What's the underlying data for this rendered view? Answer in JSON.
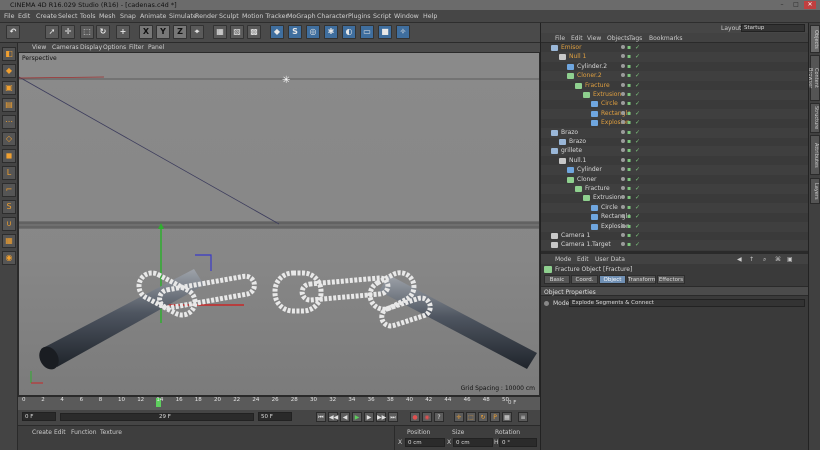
{
  "window": {
    "title": "CINEMA 4D R16.029 Studio (R16) - [cadenas.c4d *]",
    "buttons": [
      "–",
      "□",
      "✕"
    ]
  },
  "menubar": [
    "File",
    "Edit",
    "Create",
    "Select",
    "Tools",
    "Mesh",
    "Snap",
    "Animate",
    "Simulate",
    "Render",
    "Sculpt",
    "Motion Tracker",
    "MoGraph",
    "Character",
    "Plugins",
    "Script",
    "Window",
    "Help"
  ],
  "toolbar": {
    "buttons": [
      {
        "name": "undo-icon",
        "glyph": "↶"
      },
      {
        "name": "select-arrow-icon",
        "glyph": "➚"
      },
      {
        "name": "move-icon",
        "glyph": "✛"
      },
      {
        "name": "scale-icon",
        "glyph": "⬚"
      },
      {
        "name": "rotate-icon",
        "glyph": "↻"
      },
      {
        "name": "add-icon",
        "glyph": "+"
      },
      {
        "name": "x-axis-icon",
        "glyph": "X"
      },
      {
        "name": "y-axis-icon",
        "glyph": "Y"
      },
      {
        "name": "z-axis-icon",
        "glyph": "Z"
      },
      {
        "name": "coord-system-icon",
        "glyph": "⌖"
      },
      {
        "name": "render-view-icon",
        "glyph": "▦"
      },
      {
        "name": "render-picture-viewer-icon",
        "glyph": "▧"
      },
      {
        "name": "render-settings-icon",
        "glyph": "▩"
      },
      {
        "name": "cube-icon",
        "glyph": "◆"
      },
      {
        "name": "spline-icon",
        "glyph": "S"
      },
      {
        "name": "nurbs-icon",
        "glyph": "◎"
      },
      {
        "name": "array-icon",
        "glyph": "✱"
      },
      {
        "name": "deformer-icon",
        "glyph": "◐"
      },
      {
        "name": "scene-icon",
        "glyph": "▭"
      },
      {
        "name": "camera-icon",
        "glyph": "■"
      },
      {
        "name": "light-icon",
        "glyph": "✧"
      }
    ]
  },
  "left_toolbar": [
    "make-editable-icon",
    "model-mode-icon",
    "texture-mode-icon",
    "workplane-icon",
    "points-mode-icon",
    "edges-mode-icon",
    "polygons-mode-icon",
    "axis-icon",
    "tweak-icon",
    "snap-icon",
    "magnet-icon",
    "lock-icon",
    "solo-icon"
  ],
  "viewport": {
    "menu": [
      "View",
      "Cameras",
      "Display",
      "Options",
      "Filter",
      "Panel"
    ],
    "label": "Perspective",
    "grid_spacing": "Grid Spacing : 10000 cm"
  },
  "timeline": {
    "ticks": [
      "0",
      "2",
      "4",
      "6",
      "8",
      "10",
      "12",
      "14",
      "16",
      "18",
      "20",
      "22",
      "24",
      "26",
      "28",
      "30",
      "32",
      "34",
      "36",
      "38",
      "40",
      "42",
      "44",
      "46",
      "48",
      "50"
    ],
    "end_frame": "0 F"
  },
  "playbar": {
    "start": "0 F",
    "current": "29 F",
    "end": "50 F"
  },
  "material_manager": {
    "menu": [
      "Create",
      "Edit",
      "Function",
      "Texture"
    ]
  },
  "coordinates": {
    "headers": [
      "Position",
      "Size",
      "Rotation"
    ],
    "x_pos": "0 cm",
    "x_size": "0 cm",
    "x_rot": "0 °",
    "axis_labels": [
      "X",
      "X",
      "H"
    ]
  },
  "layout": {
    "label": "Layout:",
    "value": "Startup"
  },
  "object_manager": {
    "menu": [
      "File",
      "Edit",
      "View",
      "Objects",
      "Tags",
      "Bookmarks"
    ],
    "rows": [
      {
        "name": "Emisor",
        "indent": 0,
        "color": "#e0a040",
        "icon": "#9ab7d8"
      },
      {
        "name": "Null 1",
        "indent": 1,
        "color": "#e0a040",
        "icon": "#c8c8c8"
      },
      {
        "name": "Cylinder.2",
        "indent": 2,
        "color": "#d8d8d8",
        "icon": "#6fa6df"
      },
      {
        "name": "Cloner.2",
        "indent": 2,
        "color": "#e0a040",
        "icon": "#8fd08f"
      },
      {
        "name": "Fracture",
        "indent": 3,
        "color": "#e0a040",
        "icon": "#8fd08f"
      },
      {
        "name": "Extrusion",
        "indent": 4,
        "color": "#e0a040",
        "icon": "#8fd08f"
      },
      {
        "name": "Circle",
        "indent": 5,
        "color": "#e0a040",
        "icon": "#6fa6df"
      },
      {
        "name": "Rectangle",
        "indent": 5,
        "color": "#e0a040",
        "icon": "#6fa6df"
      },
      {
        "name": "Explosion",
        "indent": 5,
        "color": "#e0a040",
        "icon": "#6fa6df"
      },
      {
        "name": "Brazo",
        "indent": 0,
        "color": "#d8d8d8",
        "icon": "#9ab7d8"
      },
      {
        "name": "Brazo",
        "indent": 1,
        "color": "#d8d8d8",
        "icon": "#9ab7d8"
      },
      {
        "name": "grillete",
        "indent": 0,
        "color": "#d8d8d8",
        "icon": "#9ab7d8"
      },
      {
        "name": "Null.1",
        "indent": 1,
        "color": "#d8d8d8",
        "icon": "#c8c8c8"
      },
      {
        "name": "Cylinder",
        "indent": 2,
        "color": "#d8d8d8",
        "icon": "#6fa6df"
      },
      {
        "name": "Cloner",
        "indent": 2,
        "color": "#d8d8d8",
        "icon": "#8fd08f"
      },
      {
        "name": "Fracture",
        "indent": 3,
        "color": "#d8d8d8",
        "icon": "#8fd08f"
      },
      {
        "name": "Extrusion",
        "indent": 4,
        "color": "#d8d8d8",
        "icon": "#8fd08f"
      },
      {
        "name": "Circle",
        "indent": 5,
        "color": "#d8d8d8",
        "icon": "#6fa6df"
      },
      {
        "name": "Rectangle",
        "indent": 5,
        "color": "#d8d8d8",
        "icon": "#6fa6df"
      },
      {
        "name": "Explosion",
        "indent": 5,
        "color": "#d8d8d8",
        "icon": "#6fa6df"
      },
      {
        "name": "Camera 1",
        "indent": 0,
        "color": "#d8d8d8",
        "icon": "#c8c8c8"
      },
      {
        "name": "Camera 1.Target",
        "indent": 0,
        "color": "#d8d8d8",
        "icon": "#c8c8c8"
      }
    ]
  },
  "attributes": {
    "menu": [
      "Mode",
      "Edit",
      "User Data"
    ],
    "title": "Fracture Object [Fracture]",
    "tabs": [
      "Basic",
      "Coord.",
      "Object",
      "Transform",
      "Effectors"
    ],
    "selected_tab": "Object",
    "section": "Object Properties",
    "mode_label": "Mode",
    "mode_value": "Explode Segments & Connect"
  },
  "side_tabs": [
    "Objects",
    "Content Browser",
    "Structure",
    "Attributes",
    "Layers"
  ]
}
